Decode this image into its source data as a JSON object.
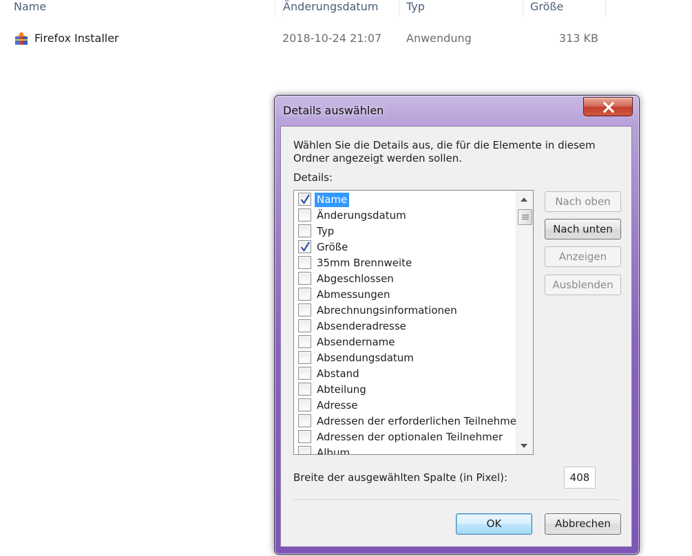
{
  "explorer": {
    "columns": {
      "name": "Name",
      "date": "Änderungsdatum",
      "type": "Typ",
      "size": "Größe"
    },
    "files": [
      {
        "name": "Firefox Installer",
        "date": "2018-10-24 21:07",
        "type": "Anwendung",
        "size": "313 KB",
        "icon": "firefox-installer-icon"
      }
    ]
  },
  "dialog": {
    "title": "Details auswählen",
    "instruction": "Wählen Sie die Details aus, die für die Elemente in diesem Ordner angezeigt werden sollen.",
    "details_label": "Details:",
    "items": [
      {
        "label": "Name",
        "checked": true,
        "selected": true
      },
      {
        "label": "Änderungsdatum",
        "checked": false
      },
      {
        "label": "Typ",
        "checked": false
      },
      {
        "label": "Größe",
        "checked": true
      },
      {
        "label": "35mm Brennweite",
        "checked": false
      },
      {
        "label": "Abgeschlossen",
        "checked": false
      },
      {
        "label": "Abmessungen",
        "checked": false
      },
      {
        "label": "Abrechnungsinformationen",
        "checked": false
      },
      {
        "label": "Absenderadresse",
        "checked": false
      },
      {
        "label": "Absendername",
        "checked": false
      },
      {
        "label": "Absendungsdatum",
        "checked": false
      },
      {
        "label": "Abstand",
        "checked": false
      },
      {
        "label": "Abteilung",
        "checked": false
      },
      {
        "label": "Adresse",
        "checked": false
      },
      {
        "label": "Adressen der erforderlichen Teilnehmer",
        "checked": false
      },
      {
        "label": "Adressen der optionalen Teilnehmer",
        "checked": false
      },
      {
        "label": "Album",
        "checked": false
      }
    ],
    "buttons": {
      "move_up": "Nach oben",
      "move_down": "Nach unten",
      "show": "Anzeigen",
      "hide": "Ausblenden",
      "ok": "OK",
      "cancel": "Abbrechen"
    },
    "width_label": "Breite der ausgewählten Spalte (in Pixel):",
    "width_value": "408"
  },
  "colors": {
    "selection": "#3399ff",
    "frame": "#8a63be",
    "close": "#c2412c"
  }
}
